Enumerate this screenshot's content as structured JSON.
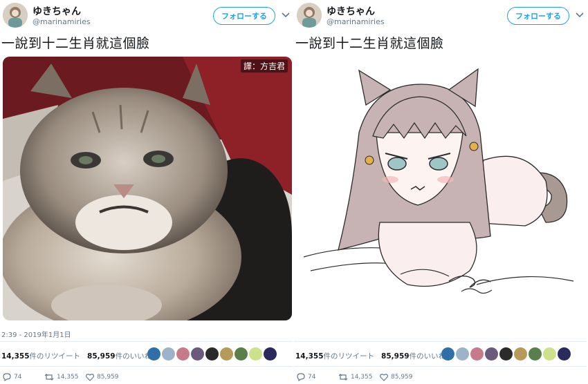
{
  "tweets": [
    {
      "user": {
        "display_name": "ゆきちゃん",
        "handle": "@marinamiries"
      },
      "follow_label": "フォローする",
      "text": "一說到十二生肖就這個臉",
      "watermark": "譯：方吉君",
      "timestamp": "2:39 - 2019年1月1日",
      "stats": {
        "retweets": "14,355",
        "retweets_label": "件のリツイート",
        "likes": "85,959",
        "likes_label": "件のいいね"
      },
      "actions": {
        "reply": "74",
        "retweet": "14,355",
        "like": "85,959"
      }
    },
    {
      "user": {
        "display_name": "ゆきちゃん",
        "handle": "@marinamiries"
      },
      "follow_label": "フォローする",
      "text": "一說到十二生肖就這個臉",
      "stats": {
        "retweets": "14,355",
        "retweets_label": "件のリツイート",
        "likes": "85,959",
        "likes_label": "件のいいね"
      },
      "actions": {
        "reply": "74",
        "retweet": "14,355",
        "like": "85,959"
      }
    }
  ],
  "icons": {
    "caret": "chevron-down-icon",
    "reply": "reply-icon",
    "retweet": "retweet-icon",
    "like": "heart-icon"
  },
  "colors": {
    "accent": "#1da1f2",
    "muted": "#657786",
    "divider": "#e6ecf0"
  }
}
